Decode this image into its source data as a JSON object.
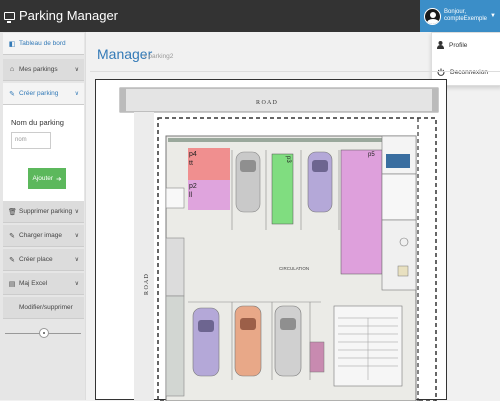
{
  "header": {
    "app_title": "Parking Manager",
    "user_line1": "Bonjour,",
    "user_line2": "compteExemple",
    "user_menu": [
      "Profile",
      "Deconnexion"
    ]
  },
  "sidebar": {
    "items": [
      {
        "label": "Tableau de bord",
        "icon": "dashboard-icon"
      },
      {
        "label": "Mes parkings",
        "icon": "home-icon"
      },
      {
        "label": "Créer parking",
        "icon": "edit-icon"
      },
      {
        "label": "Supprimer parking",
        "icon": "trash-icon"
      },
      {
        "label": "Charger image",
        "icon": "edit-icon"
      },
      {
        "label": "Créer place",
        "icon": "edit-icon"
      },
      {
        "label": "Maj Excel",
        "icon": "excel-icon"
      },
      {
        "label": "Modifier/supprimer",
        "icon": ""
      }
    ],
    "form": {
      "label": "Nom du parking",
      "placeholder": "nom",
      "button": "Ajouter"
    }
  },
  "main": {
    "title": "Manager",
    "breadcrumb": "» parking2",
    "plan": {
      "road_top": "R O A D",
      "road_left": "R O A D",
      "center_label": "CIRCULATION",
      "spots": [
        {
          "label": "p4",
          "sub": "tt",
          "color": "#f08a8a"
        },
        {
          "label": "p2",
          "sub": "ll",
          "color": "#dea0dc"
        },
        {
          "label": "p3",
          "sub": "",
          "color": "#80dd80"
        },
        {
          "label": "p5",
          "sub": "",
          "color": "#dea0dc"
        }
      ]
    }
  },
  "colors": {
    "topbar": "#333333",
    "accent": "#3b8ec8",
    "button": "#5cb85c"
  }
}
